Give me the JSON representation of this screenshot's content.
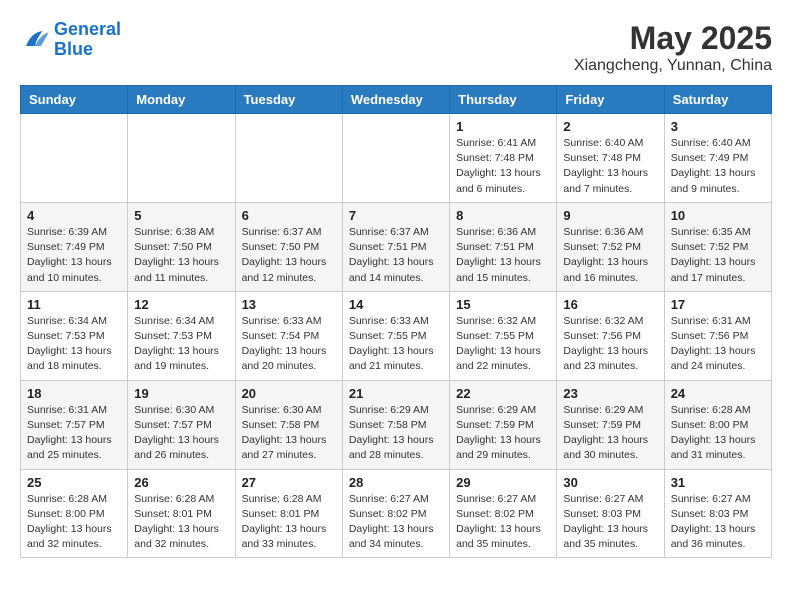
{
  "header": {
    "logo_line1": "General",
    "logo_line2": "Blue",
    "month_year": "May 2025",
    "location": "Xiangcheng, Yunnan, China"
  },
  "days_of_week": [
    "Sunday",
    "Monday",
    "Tuesday",
    "Wednesday",
    "Thursday",
    "Friday",
    "Saturday"
  ],
  "weeks": [
    {
      "days": [
        {
          "number": "",
          "info": ""
        },
        {
          "number": "",
          "info": ""
        },
        {
          "number": "",
          "info": ""
        },
        {
          "number": "",
          "info": ""
        },
        {
          "number": "1",
          "info": "Sunrise: 6:41 AM\nSunset: 7:48 PM\nDaylight: 13 hours\nand 6 minutes."
        },
        {
          "number": "2",
          "info": "Sunrise: 6:40 AM\nSunset: 7:48 PM\nDaylight: 13 hours\nand 7 minutes."
        },
        {
          "number": "3",
          "info": "Sunrise: 6:40 AM\nSunset: 7:49 PM\nDaylight: 13 hours\nand 9 minutes."
        }
      ]
    },
    {
      "days": [
        {
          "number": "4",
          "info": "Sunrise: 6:39 AM\nSunset: 7:49 PM\nDaylight: 13 hours\nand 10 minutes."
        },
        {
          "number": "5",
          "info": "Sunrise: 6:38 AM\nSunset: 7:50 PM\nDaylight: 13 hours\nand 11 minutes."
        },
        {
          "number": "6",
          "info": "Sunrise: 6:37 AM\nSunset: 7:50 PM\nDaylight: 13 hours\nand 12 minutes."
        },
        {
          "number": "7",
          "info": "Sunrise: 6:37 AM\nSunset: 7:51 PM\nDaylight: 13 hours\nand 14 minutes."
        },
        {
          "number": "8",
          "info": "Sunrise: 6:36 AM\nSunset: 7:51 PM\nDaylight: 13 hours\nand 15 minutes."
        },
        {
          "number": "9",
          "info": "Sunrise: 6:36 AM\nSunset: 7:52 PM\nDaylight: 13 hours\nand 16 minutes."
        },
        {
          "number": "10",
          "info": "Sunrise: 6:35 AM\nSunset: 7:52 PM\nDaylight: 13 hours\nand 17 minutes."
        }
      ]
    },
    {
      "days": [
        {
          "number": "11",
          "info": "Sunrise: 6:34 AM\nSunset: 7:53 PM\nDaylight: 13 hours\nand 18 minutes."
        },
        {
          "number": "12",
          "info": "Sunrise: 6:34 AM\nSunset: 7:53 PM\nDaylight: 13 hours\nand 19 minutes."
        },
        {
          "number": "13",
          "info": "Sunrise: 6:33 AM\nSunset: 7:54 PM\nDaylight: 13 hours\nand 20 minutes."
        },
        {
          "number": "14",
          "info": "Sunrise: 6:33 AM\nSunset: 7:55 PM\nDaylight: 13 hours\nand 21 minutes."
        },
        {
          "number": "15",
          "info": "Sunrise: 6:32 AM\nSunset: 7:55 PM\nDaylight: 13 hours\nand 22 minutes."
        },
        {
          "number": "16",
          "info": "Sunrise: 6:32 AM\nSunset: 7:56 PM\nDaylight: 13 hours\nand 23 minutes."
        },
        {
          "number": "17",
          "info": "Sunrise: 6:31 AM\nSunset: 7:56 PM\nDaylight: 13 hours\nand 24 minutes."
        }
      ]
    },
    {
      "days": [
        {
          "number": "18",
          "info": "Sunrise: 6:31 AM\nSunset: 7:57 PM\nDaylight: 13 hours\nand 25 minutes."
        },
        {
          "number": "19",
          "info": "Sunrise: 6:30 AM\nSunset: 7:57 PM\nDaylight: 13 hours\nand 26 minutes."
        },
        {
          "number": "20",
          "info": "Sunrise: 6:30 AM\nSunset: 7:58 PM\nDaylight: 13 hours\nand 27 minutes."
        },
        {
          "number": "21",
          "info": "Sunrise: 6:29 AM\nSunset: 7:58 PM\nDaylight: 13 hours\nand 28 minutes."
        },
        {
          "number": "22",
          "info": "Sunrise: 6:29 AM\nSunset: 7:59 PM\nDaylight: 13 hours\nand 29 minutes."
        },
        {
          "number": "23",
          "info": "Sunrise: 6:29 AM\nSunset: 7:59 PM\nDaylight: 13 hours\nand 30 minutes."
        },
        {
          "number": "24",
          "info": "Sunrise: 6:28 AM\nSunset: 8:00 PM\nDaylight: 13 hours\nand 31 minutes."
        }
      ]
    },
    {
      "days": [
        {
          "number": "25",
          "info": "Sunrise: 6:28 AM\nSunset: 8:00 PM\nDaylight: 13 hours\nand 32 minutes."
        },
        {
          "number": "26",
          "info": "Sunrise: 6:28 AM\nSunset: 8:01 PM\nDaylight: 13 hours\nand 32 minutes."
        },
        {
          "number": "27",
          "info": "Sunrise: 6:28 AM\nSunset: 8:01 PM\nDaylight: 13 hours\nand 33 minutes."
        },
        {
          "number": "28",
          "info": "Sunrise: 6:27 AM\nSunset: 8:02 PM\nDaylight: 13 hours\nand 34 minutes."
        },
        {
          "number": "29",
          "info": "Sunrise: 6:27 AM\nSunset: 8:02 PM\nDaylight: 13 hours\nand 35 minutes."
        },
        {
          "number": "30",
          "info": "Sunrise: 6:27 AM\nSunset: 8:03 PM\nDaylight: 13 hours\nand 35 minutes."
        },
        {
          "number": "31",
          "info": "Sunrise: 6:27 AM\nSunset: 8:03 PM\nDaylight: 13 hours\nand 36 minutes."
        }
      ]
    }
  ]
}
